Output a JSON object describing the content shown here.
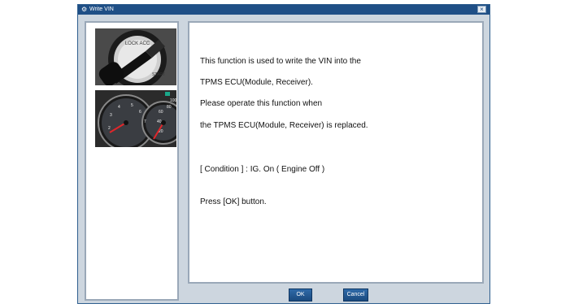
{
  "window": {
    "title": "Write VIN",
    "icon": "app-icon",
    "close_icon": "close-icon"
  },
  "images": {
    "left_top": "ignition-key-image",
    "left_bottom": "instrument-cluster-image"
  },
  "message": {
    "line1": "This function is used to write the VIN into the",
    "line2": "TPMS ECU(Module, Receiver).",
    "line3": "Please operate this function when",
    "line4": "the TPMS ECU(Module, Receiver) is replaced.",
    "line5": "[ Condition ] : IG. On ( Engine Off )",
    "line6": "Press [OK] button."
  },
  "buttons": {
    "ok": "OK",
    "cancel": "Cancel"
  },
  "colors": {
    "titlebar": "#1f4f86",
    "button": "#1b4a7e",
    "panel_border": "#9aa8b8"
  }
}
